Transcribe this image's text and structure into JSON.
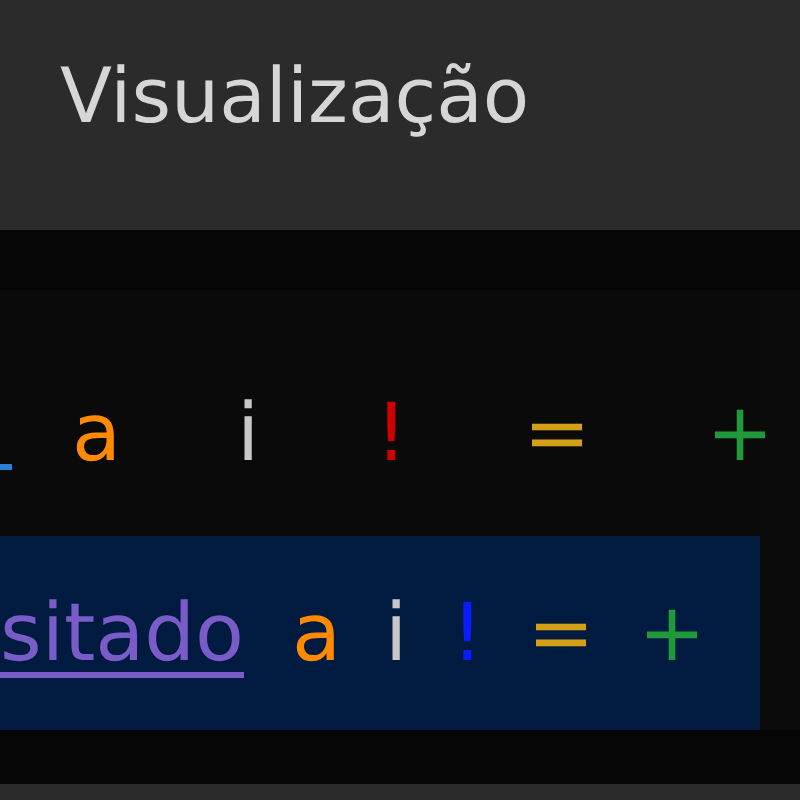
{
  "title": "Visualização",
  "rows": [
    {
      "selected": false,
      "tokens": [
        {
          "kind": "link-stub",
          "color": "#2a7fd8"
        },
        {
          "kind": "char",
          "text": "a",
          "color": "#ff8a00"
        },
        {
          "kind": "char",
          "text": "i",
          "color": "#c8c8c8"
        },
        {
          "kind": "char",
          "text": "!",
          "color": "#d00000"
        },
        {
          "kind": "char",
          "text": "=",
          "color": "#d4a017"
        },
        {
          "kind": "char",
          "text": "+",
          "color": "#1f9a3a"
        }
      ]
    },
    {
      "selected": true,
      "tokens": [
        {
          "kind": "link",
          "text": "sitado",
          "color": "#7a5cc8"
        },
        {
          "kind": "char",
          "text": "a",
          "color": "#ff8a00"
        },
        {
          "kind": "char",
          "text": "i",
          "color": "#c8c8c8"
        },
        {
          "kind": "char",
          "text": "!",
          "color": "#0a1cff"
        },
        {
          "kind": "char",
          "text": "=",
          "color": "#d4a017"
        },
        {
          "kind": "char",
          "text": "+",
          "color": "#1f9a3a"
        }
      ]
    }
  ]
}
